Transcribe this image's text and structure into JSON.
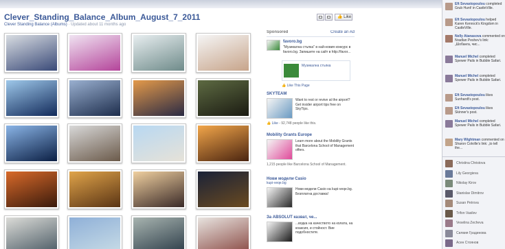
{
  "album": {
    "title": "Clever_Standing_Balance_Album_August_7_2011",
    "owner": "Clever Standing Balance (Albums)",
    "updated": "Updated about 11 months ago"
  },
  "toolbar": {
    "like_label": "Like"
  },
  "photos": [
    {
      "g1": "#d9dde2",
      "g2": "#3a4a78"
    },
    {
      "g1": "#f0e4f2",
      "g2": "#b4449a"
    },
    {
      "g1": "#e8eef0",
      "g2": "#6f8b8a"
    },
    {
      "g1": "#f5f5f5",
      "g2": "#c7a48a"
    },
    {
      "g1": "#9ec8ea",
      "g2": "#122a5a"
    },
    {
      "g1": "#9ab0d0",
      "g2": "#1d2d4c"
    },
    {
      "g1": "#e49a4a",
      "g2": "#2a2a44"
    },
    {
      "g1": "#5d6a42",
      "g2": "#1b1b12"
    },
    {
      "g1": "#8ab4e6",
      "g2": "#0b1f44"
    },
    {
      "g1": "#d8d8d8",
      "g2": "#6b5a4a"
    },
    {
      "g1": "#b8d8f2",
      "g2": "#e6e2d8"
    },
    {
      "g1": "#f2a64a",
      "g2": "#4a2410"
    },
    {
      "g1": "#d86a2a",
      "g2": "#3a1a0c"
    },
    {
      "g1": "#e0a44a",
      "g2": "#5a3414"
    },
    {
      "g1": "#f0d0a0",
      "g2": "#3a2a28"
    },
    {
      "g1": "#1a2238",
      "g2": "#6a4a20"
    },
    {
      "g1": "#dcdcd8",
      "g2": "#4a5a64"
    },
    {
      "g1": "#8fb0d8",
      "g2": "#c8dce6"
    },
    {
      "g1": "#a8b4b0",
      "g2": "#2c3c48"
    },
    {
      "g1": "#e8e4e0",
      "g2": "#8a4a44"
    }
  ],
  "ads": {
    "header": "Sponsored",
    "create_link": "Create an Ad",
    "items": [
      {
        "title": "favoro.bg",
        "text": "\"Музикална стъпка\" в най-новия конкурс в favoro.bg. Запишете на сайт в http://favor...",
        "inner_title": "Музикална стъпка",
        "like_link": "Like This Page",
        "img_color": "#3a8a3a"
      },
      {
        "title": "SKYTEAM",
        "text": "Want to rest or revive at the airport? Get insider airport tips free on SkyTips.",
        "like_link": "Like",
        "meta": "- 92,748 people like this.",
        "img_color": "#6a9ac2"
      },
      {
        "title": "Mobility Grants Europe",
        "text": "Learn more about the Mobility Grants that Barcelona School of Management offers.",
        "meta": "1,215 people like Barcelona School of Management.",
        "img_color": "#e04a9a"
      },
      {
        "title": "Нови модели Casio",
        "subtitle": "kupi-veqe.bg",
        "text": "Нови модели Casio на kupi-veqe.bg. Безплатна доставка!",
        "img_color": "#2a2a2a"
      },
      {
        "title": "За ABSOLUT казват, че...",
        "text": "...водка на качеството на колата, на коаксия, и стойност. Вие подобностите.",
        "img_color": "#1a1a1a"
      }
    ]
  },
  "ticker": {
    "stories": [
      {
        "name": "Eft Sevastopoulou",
        "text": "completed Grub Hunt! in CastleVille.",
        "color": "#b89a8a"
      },
      {
        "name": "Eft Sevastopoulou",
        "text": "helped Karen Kenrock's Kingdom in CastleVille.",
        "color": "#b89a8a"
      },
      {
        "name": "Nelly Atanasova",
        "text": "commented on Nradlan Peshev's link: „Шобанга, чис...",
        "color": "#a47a6a"
      },
      {
        "name": "Manuel Michel",
        "text": "completed Spewer Pails in Bubble Safari.",
        "color": "#8a7a9a"
      },
      {
        "name": "Manuel Michel",
        "text": "completed Spewer Pails in Bubble Safari.",
        "color": "#8a7a9a"
      },
      {
        "name": "Eft Sevastopoulou",
        "text": "likes Sunhardt's post.",
        "color": "#b89a8a"
      },
      {
        "name": "Eft Sevastopoulou",
        "text": "likes Skinner's post.",
        "color": "#b89a8a"
      },
      {
        "name": "Manuel Michel",
        "text": "completed Spewer Pails in Bubble Safari.",
        "color": "#8a7a9a"
      },
      {
        "name": "Mary Wightman",
        "text": "commented on Sharon Colville's link: „to tell the...",
        "color": "#c2a48a"
      }
    ],
    "friends": [
      {
        "name": "Christina Christova",
        "color": "#8a6a5a"
      },
      {
        "name": "Lily Georgieva",
        "color": "#6a7a9a"
      },
      {
        "name": "Nikolay Kirov",
        "color": "#7a8a7a"
      },
      {
        "name": "Stanislav Dimitrov",
        "color": "#5a5a6a"
      },
      {
        "name": "Susan Petrova",
        "color": "#a48a7a"
      },
      {
        "name": "Trifon Vasilev",
        "color": "#6a5a4a"
      },
      {
        "name": "Veselina Zecheva",
        "color": "#9a7a8a"
      },
      {
        "name": "Силвия Градинова",
        "color": "#8a8a9a"
      },
      {
        "name": "Асен Стоянов",
        "color": "#7a6a8a"
      }
    ]
  }
}
